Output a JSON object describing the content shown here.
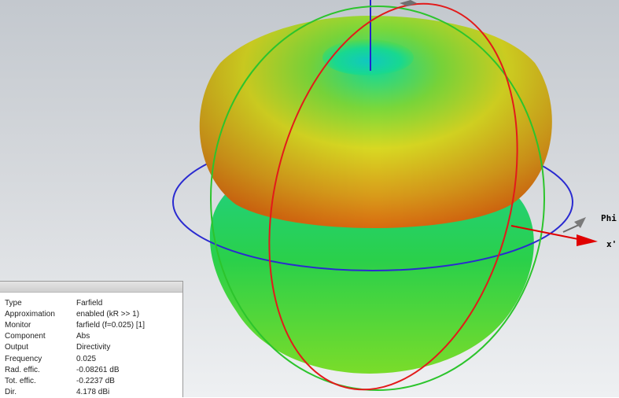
{
  "scene": {
    "axis_labels": {
      "phi": "Phi",
      "x": "x'"
    },
    "colors": {
      "background_top": "#c3c8ce",
      "background_bottom": "#eef0f2",
      "pattern_high": "#d86a10",
      "pattern_mid": "#e0e020",
      "pattern_low": "#20d060",
      "circle_theta": "#e21a1a",
      "circle_phi_green": "#2cc42c",
      "circle_equator": "#2a2ad0",
      "axis_z": "#2222cc",
      "axis_x_arrow": "#e00000"
    }
  },
  "info": {
    "rows": [
      {
        "key": "Type",
        "value": "Farfield"
      },
      {
        "key": "Approximation",
        "value": "enabled (kR >> 1)"
      },
      {
        "key": "Monitor",
        "value": "farfield (f=0.025) [1]"
      },
      {
        "key": "Component",
        "value": "Abs"
      },
      {
        "key": "Output",
        "value": "Directivity"
      },
      {
        "key": "Frequency",
        "value": "0.025"
      },
      {
        "key": "Rad. effic.",
        "value": "-0.08261 dB"
      },
      {
        "key": "Tot. effic.",
        "value": "-0.2237 dB"
      },
      {
        "key": "Dir.",
        "value": "4.178 dBi"
      }
    ]
  }
}
